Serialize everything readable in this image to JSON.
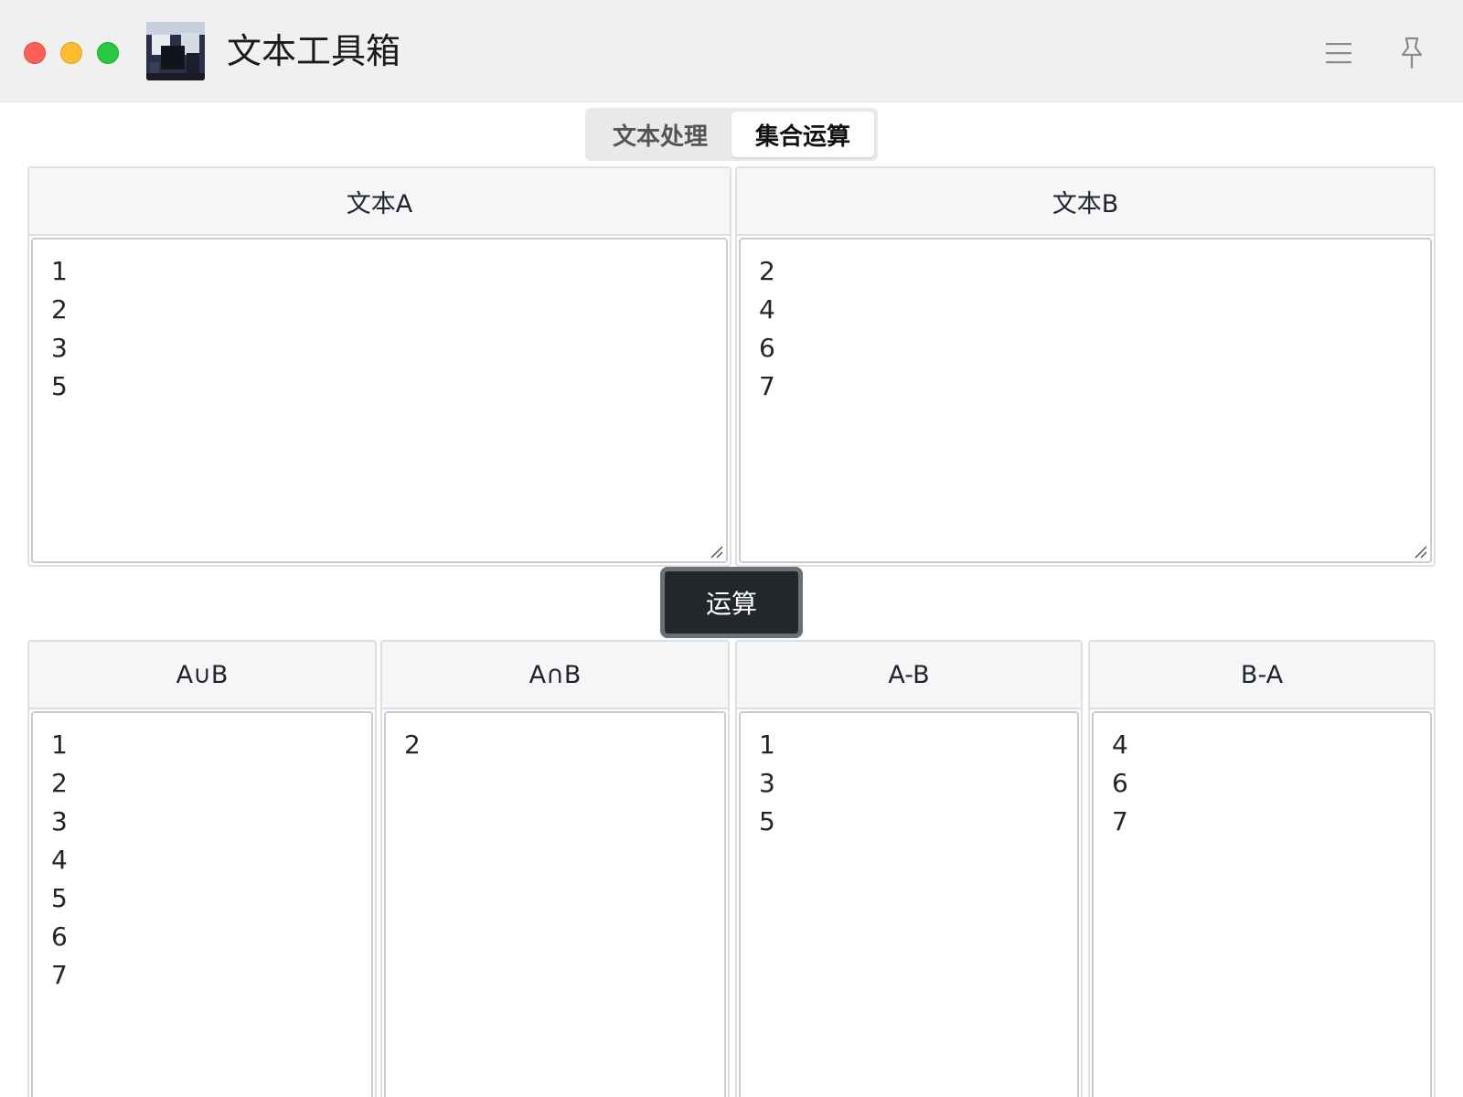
{
  "window": {
    "title": "文本工具箱"
  },
  "tabs": [
    {
      "label": "文本处理",
      "active": false
    },
    {
      "label": "集合运算",
      "active": true
    }
  ],
  "inputs": {
    "a": {
      "label": "文本A",
      "lines": [
        "1",
        "2",
        "3",
        "5"
      ]
    },
    "b": {
      "label": "文本B",
      "lines": [
        "2",
        "4",
        "6",
        "7"
      ]
    }
  },
  "run_button": {
    "label": "运算"
  },
  "results": {
    "union": {
      "label": "A∪B",
      "lines": [
        "1",
        "2",
        "3",
        "4",
        "5",
        "6",
        "7"
      ]
    },
    "intersection": {
      "label": "A∩B",
      "lines": [
        "2"
      ]
    },
    "a_minus_b": {
      "label": "A-B",
      "lines": [
        "1",
        "3",
        "5"
      ]
    },
    "b_minus_a": {
      "label": "B-A",
      "lines": [
        "4",
        "6",
        "7"
      ]
    }
  },
  "icons": {
    "menu": "hamburger-menu-icon",
    "pin": "pin-icon"
  },
  "colors": {
    "run_button_bg": "#23272b",
    "titlebar_bg": "#f0f0f0",
    "panel_header_bg": "#f5f6f8"
  }
}
